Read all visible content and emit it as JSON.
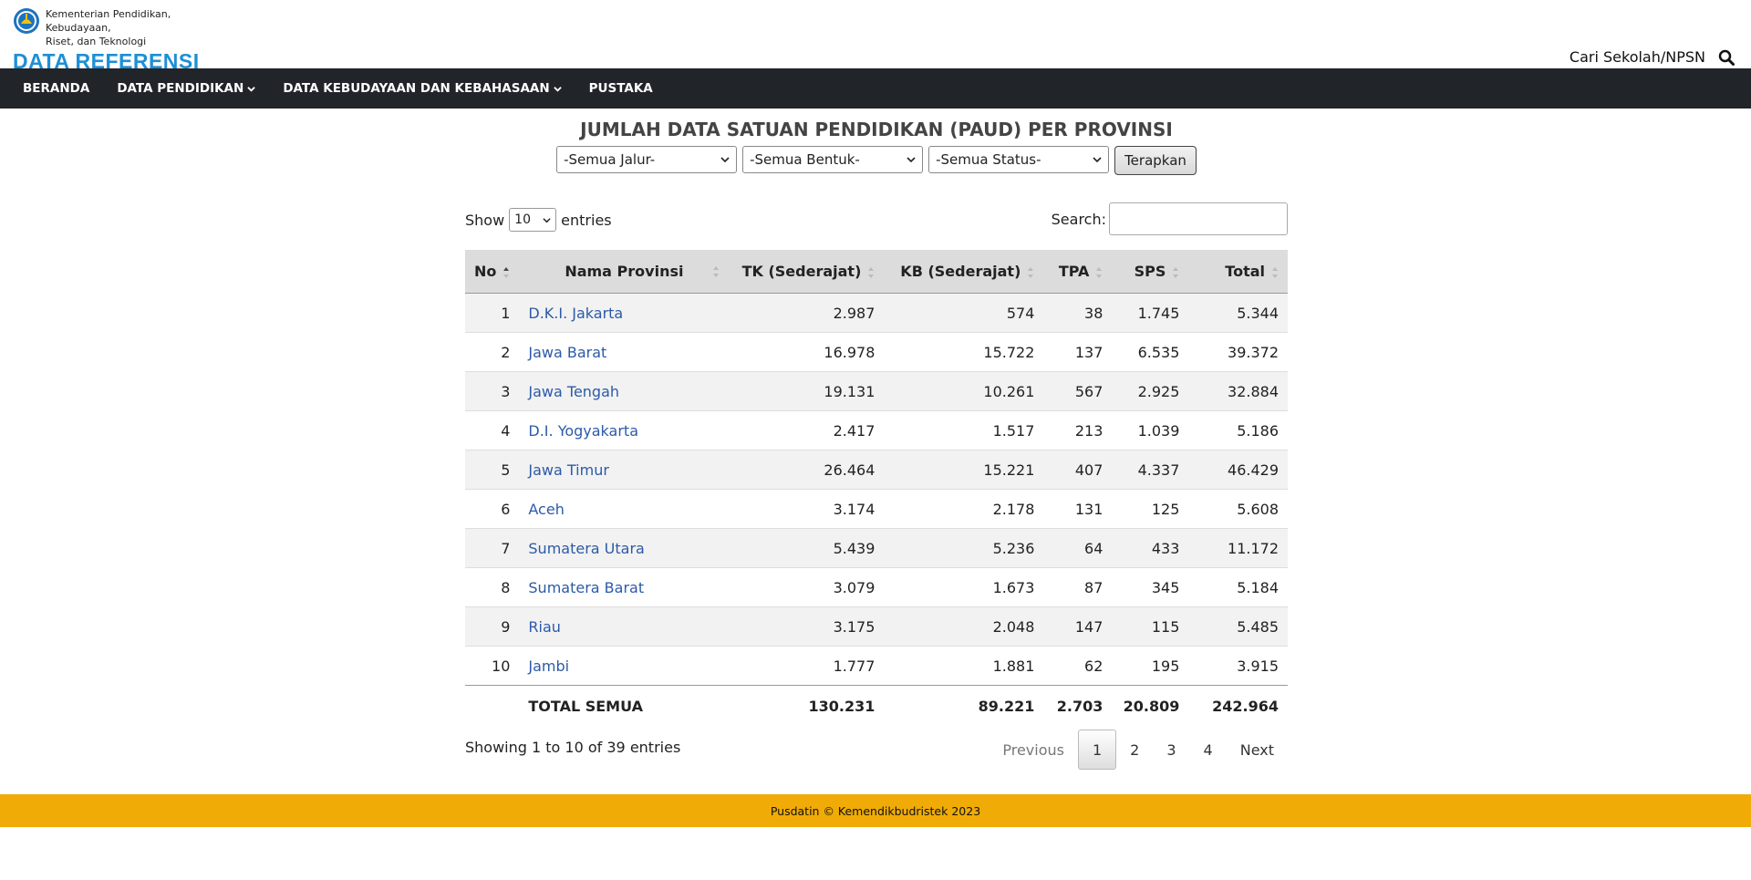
{
  "header": {
    "ministry_line1": "Kementerian Pendidikan, Kebudayaan,",
    "ministry_line2": "Riset, dan Teknologi",
    "site_title": "DATA REFERENSI",
    "search_link": "Cari Sekolah/NPSN"
  },
  "nav": [
    {
      "label": "BERANDA",
      "dropdown": false
    },
    {
      "label": "DATA PENDIDIKAN",
      "dropdown": true
    },
    {
      "label": "DATA KEBUDAYAAN DAN KEBAHASAAN",
      "dropdown": true
    },
    {
      "label": "PUSTAKA",
      "dropdown": false
    }
  ],
  "page": {
    "title": "JUMLAH DATA SATUAN PENDIDIKAN (PAUD) PER PROVINSI",
    "filters": [
      "-Semua Jalur-",
      "-Semua Bentuk-",
      "-Semua Status-"
    ],
    "apply_label": "Terapkan"
  },
  "datatable": {
    "show_label": "Show",
    "length_value": "10",
    "entries_label": "entries",
    "search_label": "Search:",
    "search_value": "",
    "columns": [
      "No",
      "Nama Provinsi",
      "TK (Sederajat)",
      "KB (Sederajat)",
      "TPA",
      "SPS",
      "Total"
    ],
    "rows": [
      [
        "1",
        "D.K.I. Jakarta",
        "2.987",
        "574",
        "38",
        "1.745",
        "5.344"
      ],
      [
        "2",
        "Jawa Barat",
        "16.978",
        "15.722",
        "137",
        "6.535",
        "39.372"
      ],
      [
        "3",
        "Jawa Tengah",
        "19.131",
        "10.261",
        "567",
        "2.925",
        "32.884"
      ],
      [
        "4",
        "D.I. Yogyakarta",
        "2.417",
        "1.517",
        "213",
        "1.039",
        "5.186"
      ],
      [
        "5",
        "Jawa Timur",
        "26.464",
        "15.221",
        "407",
        "4.337",
        "46.429"
      ],
      [
        "6",
        "Aceh",
        "3.174",
        "2.178",
        "131",
        "125",
        "5.608"
      ],
      [
        "7",
        "Sumatera Utara",
        "5.439",
        "5.236",
        "64",
        "433",
        "11.172"
      ],
      [
        "8",
        "Sumatera Barat",
        "3.079",
        "1.673",
        "87",
        "345",
        "5.184"
      ],
      [
        "9",
        "Riau",
        "3.175",
        "2.048",
        "147",
        "115",
        "5.485"
      ],
      [
        "10",
        "Jambi",
        "1.777",
        "1.881",
        "62",
        "195",
        "3.915"
      ]
    ],
    "total": {
      "label": "TOTAL SEMUA",
      "tk": "130.231",
      "kb": "89.221",
      "tpa": "2.703",
      "sps": "20.809",
      "total": "242.964"
    },
    "info": "Showing 1 to 10 of 39 entries",
    "pagination": {
      "previous": "Previous",
      "pages": [
        "1",
        "2",
        "3",
        "4"
      ],
      "current": "1",
      "next": "Next"
    }
  },
  "footer": {
    "text": "Pusdatin © Kemendikbudristek 2023"
  },
  "colors": {
    "brand_blue": "#1e8fd6",
    "nav_bg": "#212529",
    "footer_bg": "#f0ab06",
    "link": "#2c5aa8"
  }
}
